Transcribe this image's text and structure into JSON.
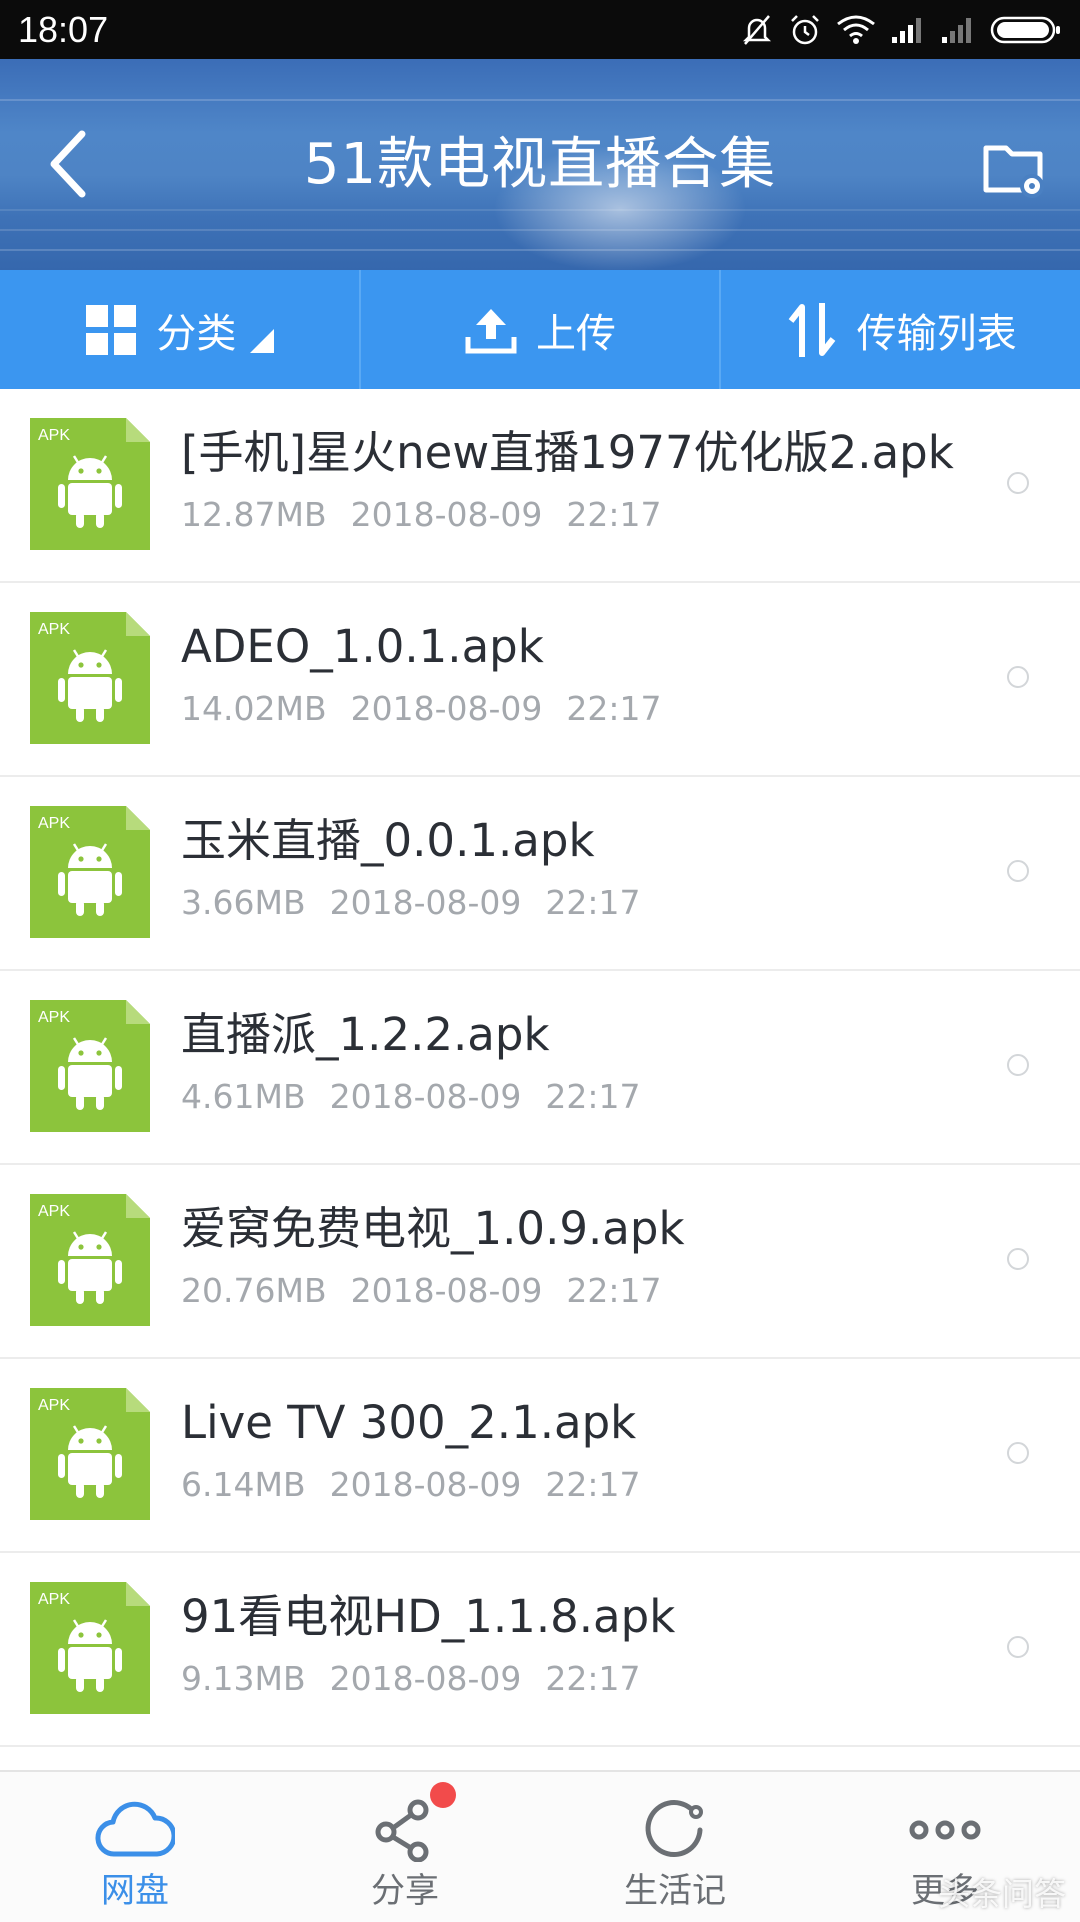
{
  "status_bar": {
    "time": "18:07",
    "icons": [
      "bell-muted-icon",
      "alarm-icon",
      "wifi-icon",
      "signal-icon",
      "signal-icon",
      "battery-icon"
    ]
  },
  "header": {
    "title": "51款电视直播合集",
    "back_icon": "chevron-left-icon",
    "settings_icon": "folder-settings-icon"
  },
  "toolbar": {
    "category_label": "分类",
    "upload_label": "上传",
    "transfer_label": "传输列表"
  },
  "files": [
    {
      "name": "[手机]星火new直播1977优化版2.apk",
      "size": "12.87MB",
      "date": "2018-08-09",
      "time": "22:17"
    },
    {
      "name": "ADEO_1.0.1.apk",
      "size": "14.02MB",
      "date": "2018-08-09",
      "time": "22:17"
    },
    {
      "name": "玉米直播_0.0.1.apk",
      "size": "3.66MB",
      "date": "2018-08-09",
      "time": "22:17"
    },
    {
      "name": "直播派_1.2.2.apk",
      "size": "4.61MB",
      "date": "2018-08-09",
      "time": "22:17"
    },
    {
      "name": "爱窝免费电视_1.0.9.apk",
      "size": "20.76MB",
      "date": "2018-08-09",
      "time": "22:17"
    },
    {
      "name": "Live TV 300_2.1.apk",
      "size": "6.14MB",
      "date": "2018-08-09",
      "time": "22:17"
    },
    {
      "name": "91看电视HD_1.1.8.apk",
      "size": "9.13MB",
      "date": "2018-08-09",
      "time": "22:17"
    }
  ],
  "apk_badge": "APK",
  "bottom_nav": {
    "items": [
      {
        "label": "网盘",
        "icon": "cloud-icon"
      },
      {
        "label": "分享",
        "icon": "share-icon"
      },
      {
        "label": "生活记",
        "icon": "refresh-circle-icon"
      },
      {
        "label": "更多",
        "icon": "more-dots-icon"
      }
    ]
  },
  "watermark": "头条问答",
  "colors": {
    "toolbar": "#3b96f0",
    "apk_green": "#8cc43c",
    "nav_active": "#3b8fe8",
    "badge_red": "#f24b4b"
  }
}
